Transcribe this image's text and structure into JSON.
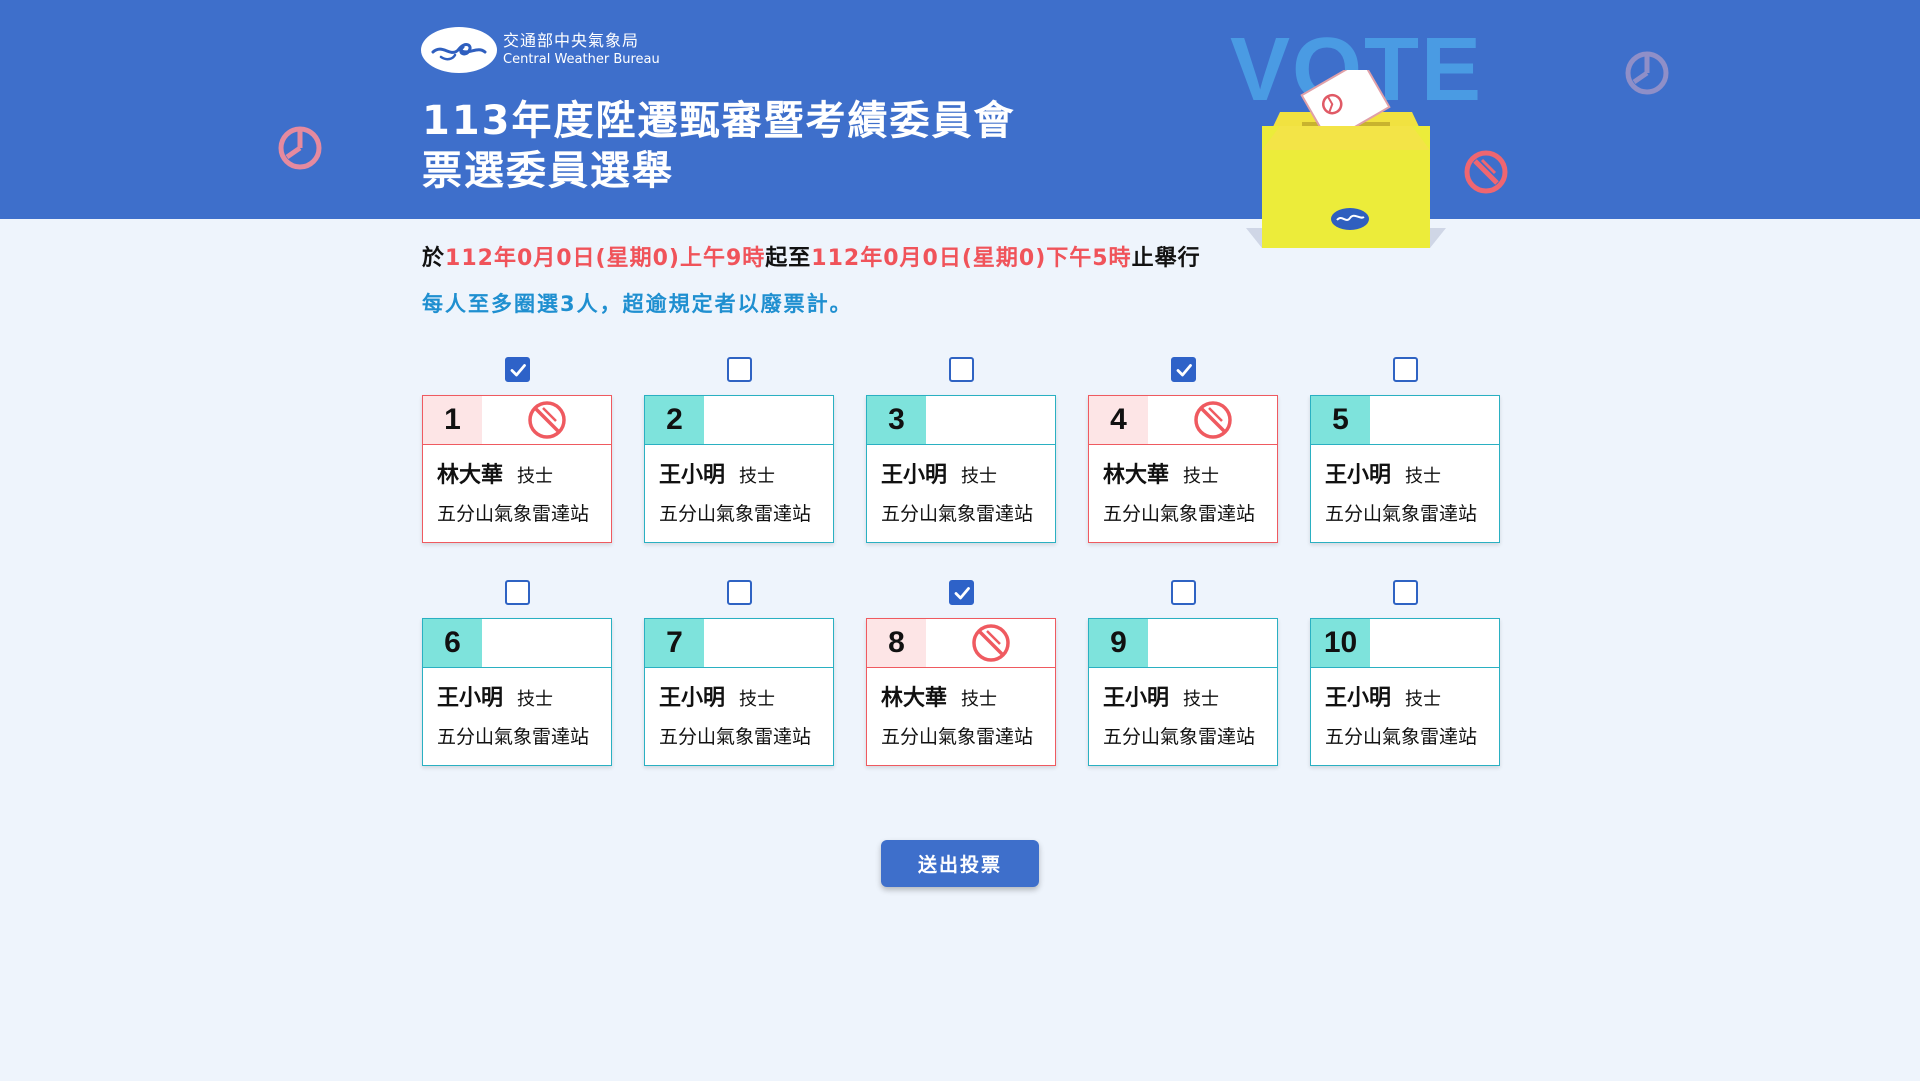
{
  "org": {
    "name_zh": "交通部中央氣象局",
    "name_en": "Central Weather Bureau"
  },
  "title": {
    "line1": "113年度陞遷甄審暨考績委員會",
    "line2": "票選委員選舉"
  },
  "hero": {
    "vote_text": "VOTE"
  },
  "schedule": {
    "prefix": "於",
    "start": "112年0月0日(星期0)上午9時",
    "mid": "起至",
    "end": "112年0月0日(星期0)下午5時",
    "suffix": "止舉行"
  },
  "rule": "每人至多圈選3人，超逾規定者以廢票計。",
  "candidates": [
    {
      "number": "1",
      "name": "林大華",
      "role": "技士",
      "station": "五分山氣象雷達站",
      "selected": true
    },
    {
      "number": "2",
      "name": "王小明",
      "role": "技士",
      "station": "五分山氣象雷達站",
      "selected": false
    },
    {
      "number": "3",
      "name": "王小明",
      "role": "技士",
      "station": "五分山氣象雷達站",
      "selected": false
    },
    {
      "number": "4",
      "name": "林大華",
      "role": "技士",
      "station": "五分山氣象雷達站",
      "selected": true
    },
    {
      "number": "5",
      "name": "王小明",
      "role": "技士",
      "station": "五分山氣象雷達站",
      "selected": false
    },
    {
      "number": "6",
      "name": "王小明",
      "role": "技士",
      "station": "五分山氣象雷達站",
      "selected": false
    },
    {
      "number": "7",
      "name": "王小明",
      "role": "技士",
      "station": "五分山氣象雷達站",
      "selected": false
    },
    {
      "number": "8",
      "name": "林大華",
      "role": "技士",
      "station": "五分山氣象雷達站",
      "selected": true
    },
    {
      "number": "9",
      "name": "王小明",
      "role": "技士",
      "station": "五分山氣象雷達站",
      "selected": false
    },
    {
      "number": "10",
      "name": "王小明",
      "role": "技士",
      "station": "五分山氣象雷達站",
      "selected": false
    }
  ],
  "submit_label": "送出投票",
  "colors": {
    "brand_blue": "#3e6fcb",
    "accent_red": "#f0535a",
    "accent_teal": "#7ee3dc",
    "rule_blue": "#1f8fd0"
  }
}
